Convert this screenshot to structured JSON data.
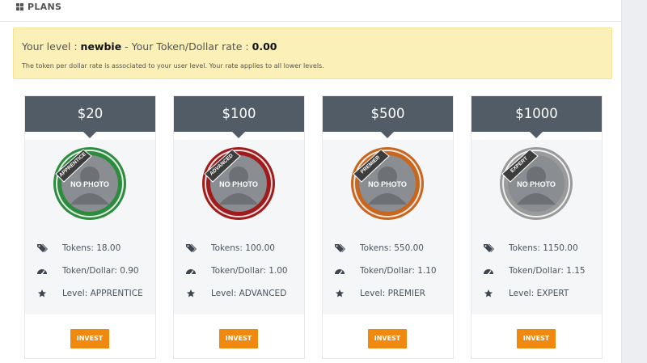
{
  "header": {
    "icon": "grid-icon",
    "title": "PLANS"
  },
  "alert": {
    "level_prefix": "Your level : ",
    "level": "newbie",
    "rate_prefix": " - Your Token/Dollar rate : ",
    "rate": "0.00",
    "note": "The token per dollar rate is associated to your user level. Your rate applies to all lower levels."
  },
  "plans": [
    {
      "price": "$20",
      "badge_text": "APPRENTICE",
      "badge_color": "#2e8b3f",
      "photo_text": "NO PHOTO",
      "tokens": "Tokens: 18.00",
      "rate": "Token/Dollar: 0.90",
      "level": "Level: APPRENTICE",
      "invest": "INVEST"
    },
    {
      "price": "$100",
      "badge_text": "ADVANCED",
      "badge_color": "#a01c1c",
      "photo_text": "NO PHOTO",
      "tokens": "Tokens: 100.00",
      "rate": "Token/Dollar: 1.00",
      "level": "Level: ADVANCED",
      "invest": "INVEST"
    },
    {
      "price": "$500",
      "badge_text": "PREMIER",
      "badge_color": "#c8661f",
      "photo_text": "NO PHOTO",
      "tokens": "Tokens: 550.00",
      "rate": "Token/Dollar: 1.10",
      "level": "Level: PREMIER",
      "invest": "INVEST"
    },
    {
      "price": "$1000",
      "badge_text": "EXPERT",
      "badge_color": "#9a9a9a",
      "photo_text": "NO PHOTO",
      "tokens": "Tokens: 1150.00",
      "rate": "Token/Dollar: 1.15",
      "level": "Level: EXPERT",
      "invest": "INVEST"
    }
  ],
  "icons": {
    "tokens": "tags-icon",
    "rate": "dashboard-icon",
    "level": "star-icon"
  },
  "colors": {
    "header_bg": "#525c66",
    "invest_bg": "#f0890f",
    "alert_bg": "#fbf0b8"
  }
}
